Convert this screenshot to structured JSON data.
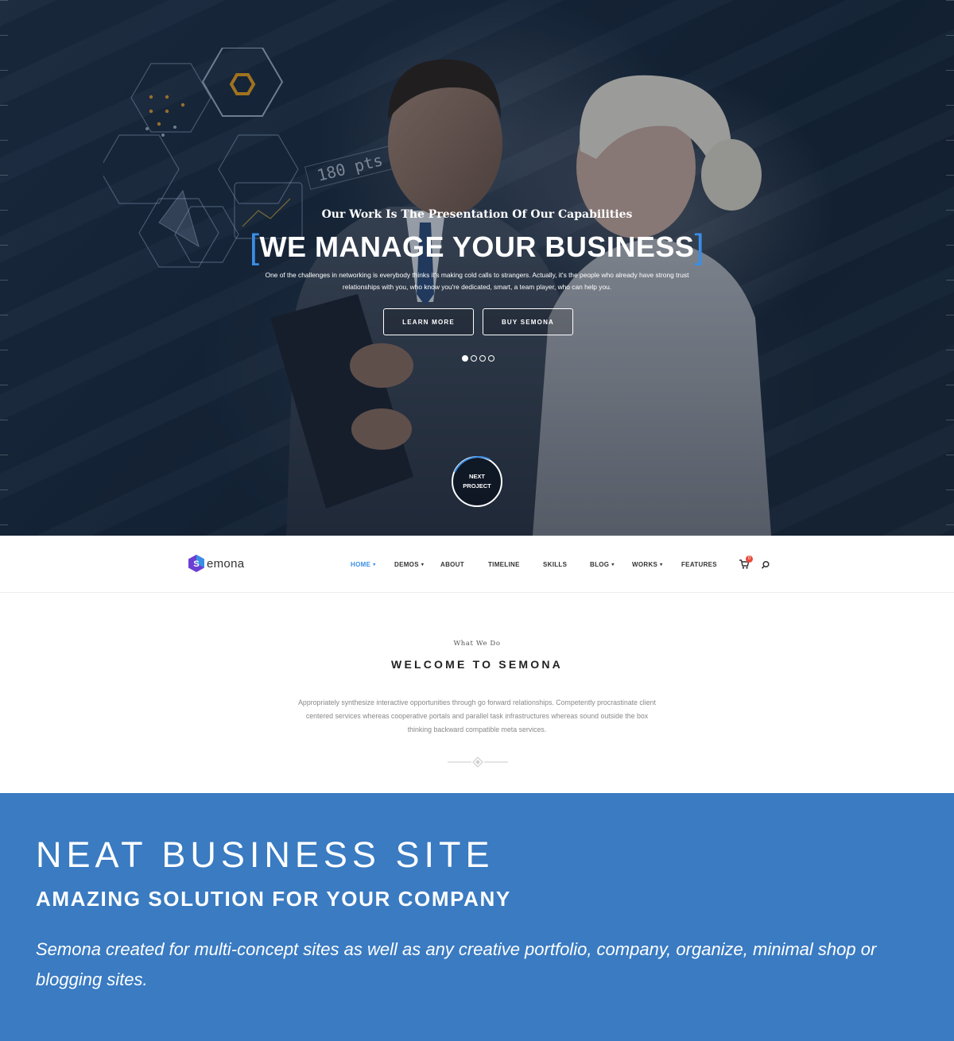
{
  "hero": {
    "kicker": "Our Work Is The Presentation Of Our Capabilities",
    "title_bracket_left": "[",
    "title": "WE MANAGE YOUR BUSINESS",
    "title_bracket_right": "]",
    "description": "One of the challenges in networking is everybody thinks it's making cold calls to strangers. Actually, it's the people who already have strong trust relationships with you, who know you're dedicated, smart, a team player, who can help you.",
    "learn_more_label": "LEARN MORE",
    "buy_label": "BUY SEMONA",
    "slider_dots": 4,
    "active_dot": 1,
    "next_line1": "NEXT",
    "next_line2": "PROJECT",
    "holo_readout": "180 pts",
    "accent_color": "#3a8ee6"
  },
  "nav": {
    "logo_text": "emona",
    "logo_icon": "hexagon-s-logo",
    "items": [
      {
        "label": "HOME",
        "dropdown": true,
        "active": true
      },
      {
        "label": "DEMOS",
        "dropdown": true,
        "active": false
      },
      {
        "label": "ABOUT",
        "dropdown": false,
        "active": false
      },
      {
        "label": "TIMELINE",
        "dropdown": false,
        "active": false
      },
      {
        "label": "SKILLS",
        "dropdown": false,
        "active": false
      },
      {
        "label": "BLOG",
        "dropdown": true,
        "active": false
      },
      {
        "label": "WORKS",
        "dropdown": true,
        "active": false
      },
      {
        "label": "FEATURES",
        "dropdown": false,
        "active": false
      }
    ],
    "caret": "▾",
    "cart_count": "0",
    "cart_icon": "cart-icon",
    "search_icon": "search-icon"
  },
  "welcome": {
    "kicker": "What We Do",
    "title": "WELCOME TO SEMONA",
    "text": "Appropriately synthesize interactive opportunities through go forward relationships. Competently procrastinate client centered services whereas cooperative portals and parallel task infrastructures whereas sound outside the box thinking backward compatible meta services."
  },
  "banner": {
    "title": "NEAT BUSINESS SITE",
    "subtitle": "AMAZING SOLUTION FOR YOUR COMPANY",
    "text": "Semona created for multi-concept sites as well as any creative portfolio, company, organize, minimal shop or blogging sites.",
    "background_color": "#3a7bc2"
  }
}
